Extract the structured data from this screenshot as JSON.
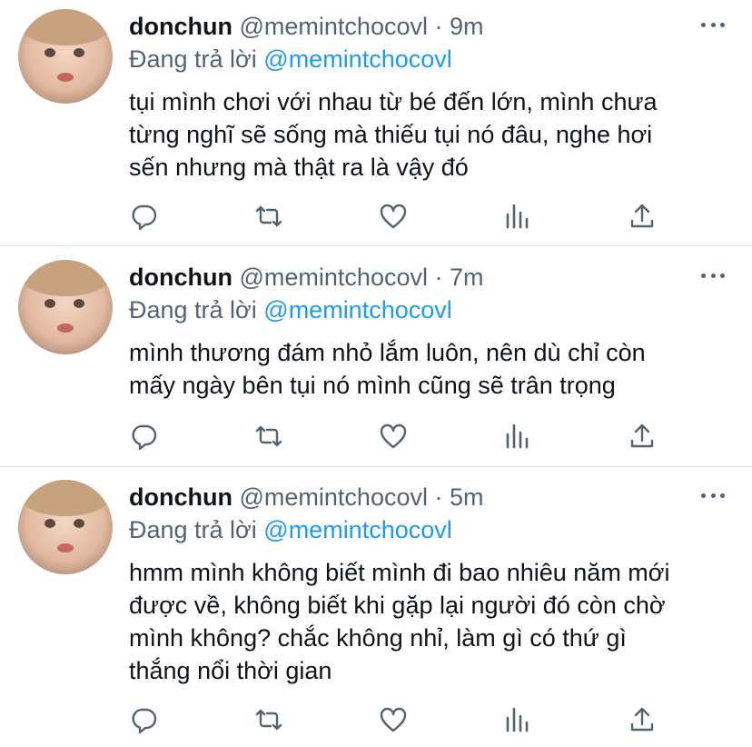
{
  "tweets": [
    {
      "name": "donchun",
      "handle": "@memintchocovl",
      "dot": "·",
      "time": "9m",
      "reply_prefix": "Đang trả lời",
      "reply_to": "@memintchocovl",
      "lines": [
        "tụi mình chơi với nhau từ bé đến lớn, mình chưa",
        "từng nghĩ sẽ sống mà thiếu tụi nó đâu, nghe hơi",
        "sến nhưng mà thật ra là vậy đó"
      ]
    },
    {
      "name": "donchun",
      "handle": "@memintchocovl",
      "dot": "·",
      "time": "7m",
      "reply_prefix": "Đang trả lời",
      "reply_to": "@memintchocovl",
      "lines": [
        "mình thương đám nhỏ lắm luôn, nên dù chỉ còn",
        "mấy ngày bên tụi nó mình cũng sẽ trân trọng"
      ]
    },
    {
      "name": "donchun",
      "handle": "@memintchocovl",
      "dot": "·",
      "time": "5m",
      "reply_prefix": "Đang trả lời",
      "reply_to": "@memintchocovl",
      "lines": [
        "hmm mình không biết mình đi bao nhiêu năm mới",
        "được về, không biết khi gặp lại người đó còn chờ",
        "mình không? chắc không nhỉ, làm gì có thứ gì",
        "thắng nổi thời gian"
      ]
    }
  ],
  "icons": [
    "reply-icon",
    "retweet-icon",
    "like-icon",
    "analytics-icon",
    "share-icon",
    "more-icon"
  ],
  "colors": {
    "text": "#0f1419",
    "secondary": "#536471",
    "link": "#1d9bf0",
    "divider": "#e1e6ea"
  }
}
